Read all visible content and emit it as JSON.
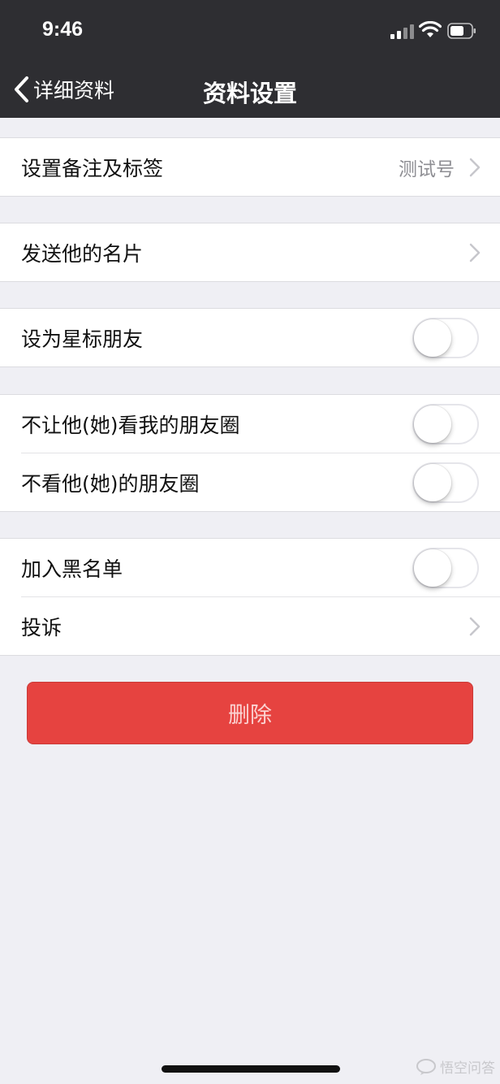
{
  "status_bar": {
    "time": "9:46"
  },
  "nav": {
    "back_label": "详细资料",
    "title": "资料设置"
  },
  "groups": [
    {
      "rows": [
        {
          "label": "设置备注及标签",
          "value": "测试号",
          "control": "chevron"
        }
      ]
    },
    {
      "rows": [
        {
          "label": "发送他的名片",
          "control": "chevron"
        }
      ]
    },
    {
      "rows": [
        {
          "label": "设为星标朋友",
          "control": "toggle",
          "on": false
        }
      ]
    },
    {
      "rows": [
        {
          "label": "不让他(她)看我的朋友圈",
          "control": "toggle",
          "on": false
        },
        {
          "label": "不看他(她)的朋友圈",
          "control": "toggle",
          "on": false
        }
      ]
    },
    {
      "rows": [
        {
          "label": "加入黑名单",
          "control": "toggle",
          "on": false
        },
        {
          "label": "投诉",
          "control": "chevron"
        }
      ]
    }
  ],
  "delete_button": {
    "label": "删除"
  },
  "watermark": {
    "text": "悟空问答"
  },
  "colors": {
    "nav_bg": "#2e2e32",
    "page_bg": "#efeff4",
    "danger": "#e64340"
  }
}
